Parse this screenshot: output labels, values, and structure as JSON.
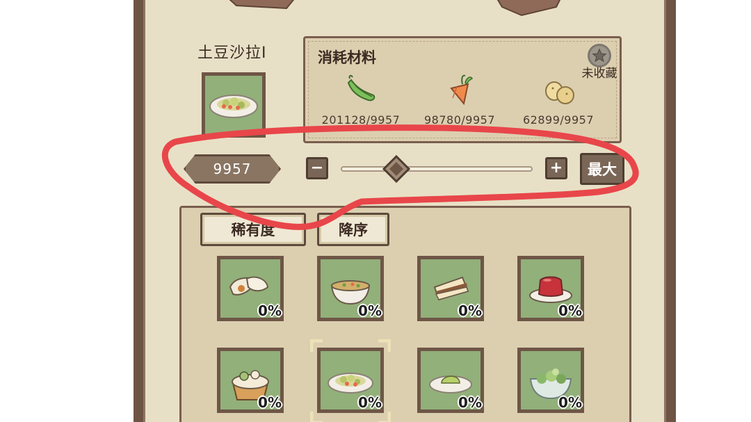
{
  "dish": {
    "name": "土豆沙拉I"
  },
  "materials": {
    "title": "消耗材料",
    "favorite_label": "未收藏",
    "items": [
      {
        "icon": "green-bean-icon",
        "count": "201128/9957"
      },
      {
        "icon": "carrot-icon",
        "count": "98780/9957"
      },
      {
        "icon": "potato-icon",
        "count": "62899/9957"
      }
    ]
  },
  "quantity": {
    "value": "9957",
    "minus": "−",
    "plus": "+",
    "max_label": "最大",
    "slider_level": 0.29
  },
  "sort": {
    "rarity_label": "稀有度",
    "order_label": "降序"
  },
  "recipes": [
    {
      "icon": "dumpling-icon",
      "pct": "0%"
    },
    {
      "icon": "soup-bowl-icon",
      "pct": "0%"
    },
    {
      "icon": "sandwich-icon",
      "pct": "0%"
    },
    {
      "icon": "jelly-icon",
      "pct": "0%"
    },
    {
      "icon": "tart-icon",
      "pct": "0%"
    },
    {
      "icon": "potato-salad-icon",
      "pct": "0%",
      "selected": true
    },
    {
      "icon": "mashed-dish-icon",
      "pct": "0%"
    },
    {
      "icon": "salad-bowl-icon",
      "pct": "0%"
    }
  ],
  "colors": {
    "panel": "#e8e0c6",
    "frame": "#6e5444",
    "card_green": "#92b07a",
    "annotation_red": "#e8464a"
  }
}
